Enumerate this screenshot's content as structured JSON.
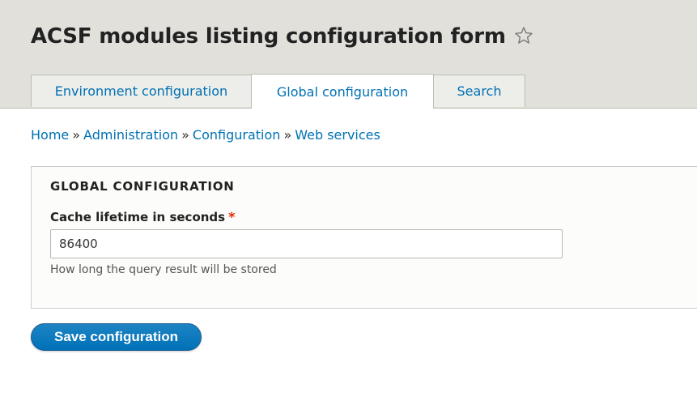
{
  "page": {
    "title": "ACSF modules listing configuration form"
  },
  "tabs": [
    {
      "label": "Environment configuration",
      "active": false
    },
    {
      "label": "Global configuration",
      "active": true
    },
    {
      "label": "Search",
      "active": false
    }
  ],
  "breadcrumb": {
    "items": [
      "Home",
      "Administration",
      "Configuration",
      "Web services"
    ],
    "separator": "»"
  },
  "fieldset": {
    "legend": "GLOBAL CONFIGURATION",
    "field": {
      "label": "Cache lifetime in seconds",
      "required_marker": "*",
      "value": "86400",
      "description": "How long the query result will be stored"
    }
  },
  "actions": {
    "save_label": "Save configuration"
  },
  "colors": {
    "link": "#0071b3",
    "header_bg": "#e1e0da",
    "button_bg": "#0071b8",
    "required": "#e32700"
  },
  "icons": {
    "shortcut": "star-icon"
  }
}
